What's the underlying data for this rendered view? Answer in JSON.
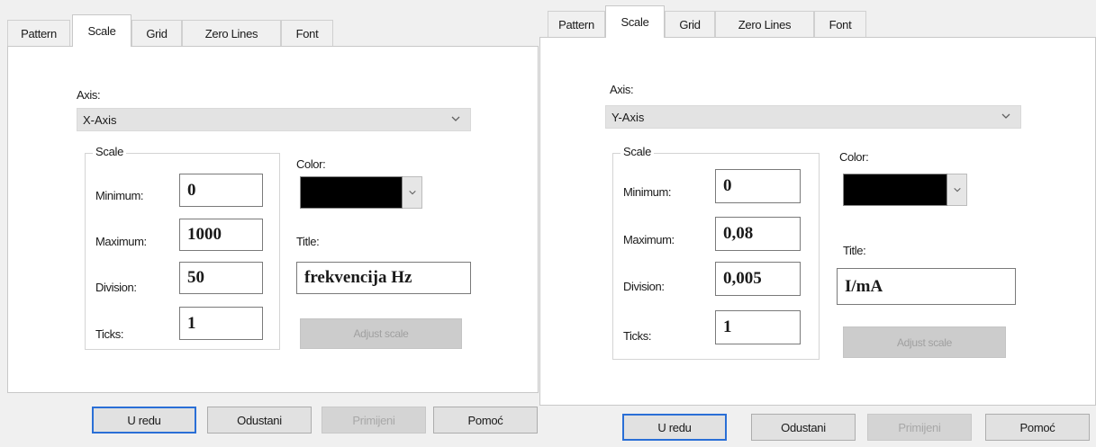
{
  "left": {
    "tabs": [
      "Pattern",
      "Scale",
      "Grid",
      "Zero Lines",
      "Font"
    ],
    "axis_label": "Axis:",
    "axis_value": "X-Axis",
    "scale_group": "Scale",
    "minimum_label": "Minimum:",
    "minimum_value": "0",
    "maximum_label": "Maximum:",
    "maximum_value": "1000",
    "division_label": "Division:",
    "division_value": "50",
    "ticks_label": "Ticks:",
    "ticks_value": "1",
    "color_label": "Color:",
    "color_value": "#000000",
    "title_label": "Title:",
    "title_value": "frekvencija Hz",
    "adjust_label": "Adjust scale",
    "buttons": [
      "U redu",
      "Odustani",
      "Primijeni",
      "Pomoć"
    ]
  },
  "right": {
    "tabs": [
      "Pattern",
      "Scale",
      "Grid",
      "Zero Lines",
      "Font"
    ],
    "axis_label": "Axis:",
    "axis_value": "Y-Axis",
    "scale_group": "Scale",
    "minimum_label": "Minimum:",
    "minimum_value": "0",
    "maximum_label": "Maximum:",
    "maximum_value": "0,08",
    "division_label": "Division:",
    "division_value": "0,005",
    "ticks_label": "Ticks:",
    "ticks_value": "1",
    "color_label": "Color:",
    "color_value": "#000000",
    "title_label": "Title:",
    "title_value": "I/mA",
    "adjust_label": "Adjust scale",
    "buttons": [
      "U redu",
      "Odustani",
      "Primijeni",
      "Pomoć"
    ]
  },
  "icons": {
    "dropdown": "chevron-down-icon",
    "color_dropdown": "chevron-down-icon"
  }
}
